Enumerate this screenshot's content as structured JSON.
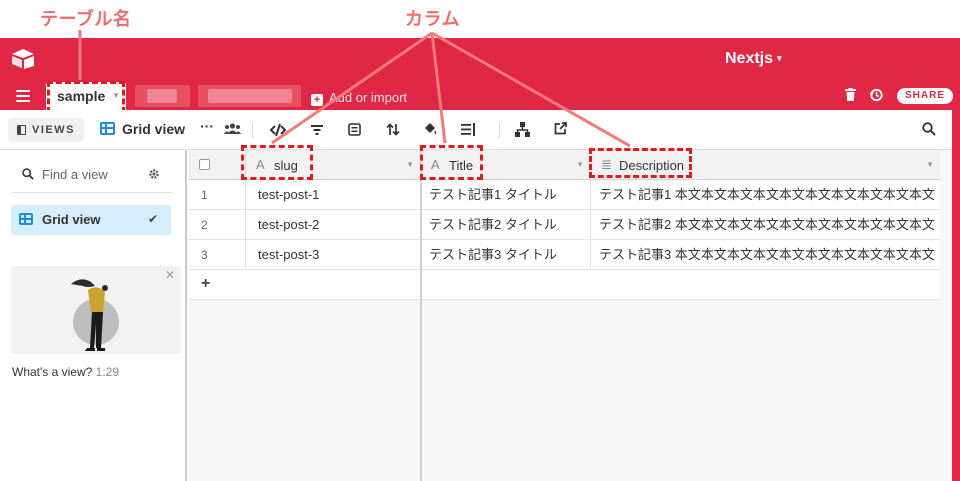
{
  "annotations": {
    "table_name": "テーブル名",
    "column": "カラム"
  },
  "app": {
    "title": "Nextjs",
    "caret": "▾"
  },
  "tabs": {
    "active": "sample",
    "add_import": "Add or import"
  },
  "actions": {
    "share": "SHARE"
  },
  "toolbar": {
    "views": "VIEWS",
    "view_name": "Grid view"
  },
  "sidebar": {
    "find_placeholder": "Find a view",
    "views": [
      {
        "name": "Grid view",
        "selected": true
      }
    ],
    "video_caption": "What's a view?",
    "video_duration": "1:29"
  },
  "grid": {
    "columns": [
      {
        "type_icon": "A",
        "name": "slug"
      },
      {
        "type_icon": "A",
        "name": "Title"
      },
      {
        "type_icon": "≣",
        "name": "Description"
      }
    ],
    "rows": [
      {
        "num": "1",
        "slug": "test-post-1",
        "title": "テスト記事1 タイトル",
        "description": "テスト記事1 本文本文本文本文本文本文本文本文本文本文"
      },
      {
        "num": "2",
        "slug": "test-post-2",
        "title": "テスト記事2 タイトル",
        "description": "テスト記事2 本文本文本文本文本文本文本文本文本文本文"
      },
      {
        "num": "3",
        "slug": "test-post-3",
        "title": "テスト記事3 タイトル",
        "description": "テスト記事3 本文本文本文本文本文本文本文本文本文本文"
      }
    ],
    "add_row": "+"
  },
  "colors": {
    "brand": "#e02745",
    "accent": "#1d8ae3",
    "annotation": "#f06b6b",
    "annotation_box": "#e11b1b"
  }
}
